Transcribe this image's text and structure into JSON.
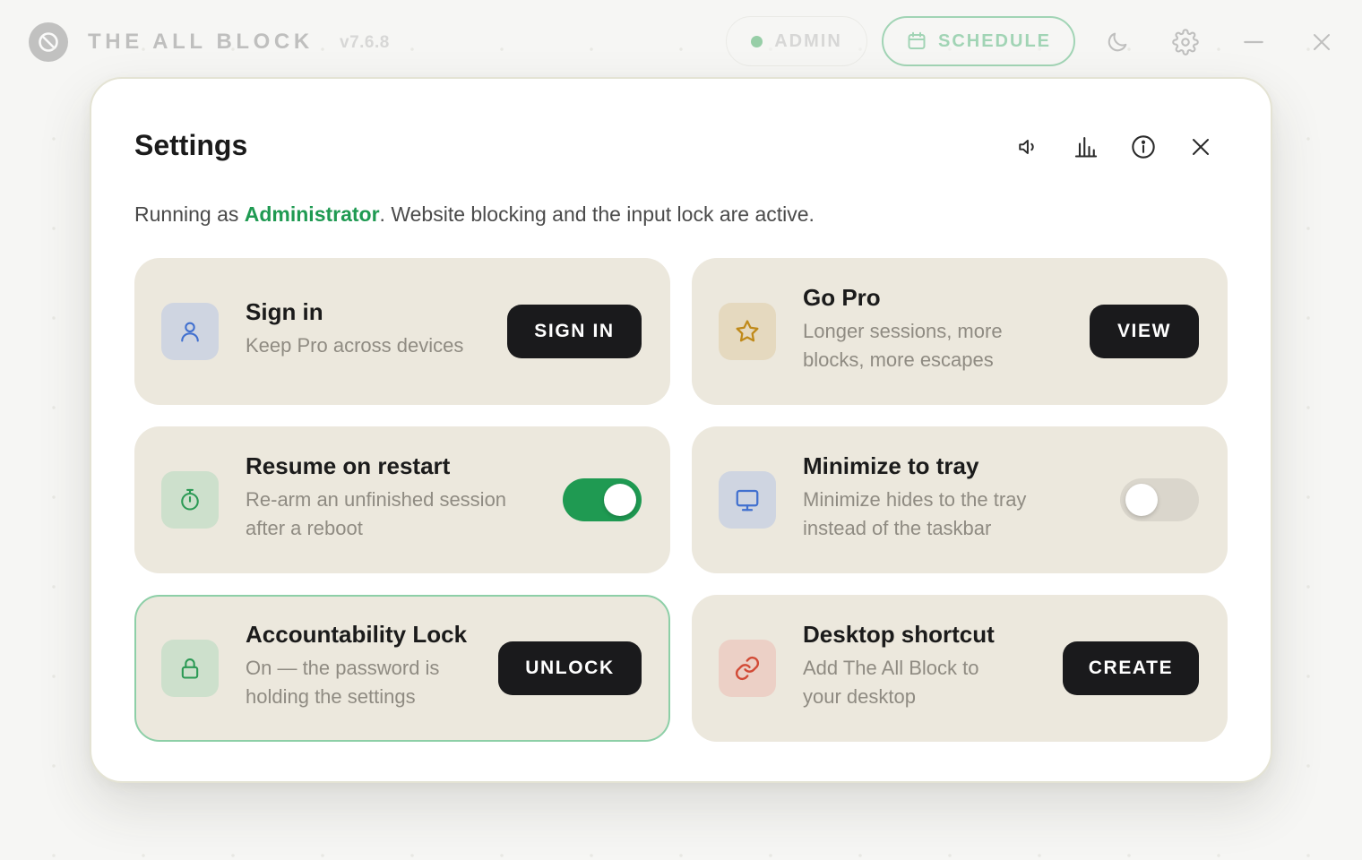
{
  "app": {
    "name": "THE ALL BLOCK",
    "version": "v7.6.8",
    "admin_label": "ADMIN",
    "schedule_label": "SCHEDULE"
  },
  "modal": {
    "title": "Settings",
    "status": {
      "prefix": "Running as ",
      "role": "Administrator",
      "suffix": ". Website blocking and the input lock are active."
    }
  },
  "cards": {
    "sign_in": {
      "title": "Sign in",
      "desc": "Keep Pro across devices",
      "button": "SIGN IN"
    },
    "go_pro": {
      "title": "Go Pro",
      "desc": [
        "Longer sessions, more",
        "blocks, more escapes"
      ],
      "button": "VIEW"
    },
    "resume": {
      "title": "Resume on restart",
      "desc": [
        "Re-arm an unfinished session",
        "after a reboot"
      ],
      "enabled": true
    },
    "tray": {
      "title": "Minimize to tray",
      "desc": [
        "Minimize hides to the tray",
        "instead of the taskbar"
      ],
      "enabled": false
    },
    "lock": {
      "title": "Accountability Lock",
      "desc": [
        "On — the password is",
        "holding the settings"
      ],
      "button": "UNLOCK"
    },
    "shortcut": {
      "title": "Desktop shortcut",
      "desc": [
        "Add The All Block to",
        "your desktop"
      ],
      "button": "CREATE"
    }
  },
  "icons": {
    "logo": "block-icon",
    "schedule": "calendar-icon",
    "theme": "moon-icon",
    "settings": "gear-icon",
    "minimize": "minimize-icon",
    "close": "close-icon",
    "sound": "speaker-icon",
    "stats": "bar-chart-icon",
    "info": "info-icon",
    "modal_close": "close-icon"
  },
  "colors": {
    "accent_green": "#1f9a52",
    "card_bg": "#ece8dd",
    "button_bg": "#1a1a1c",
    "schedule_green": "#4fb477"
  }
}
